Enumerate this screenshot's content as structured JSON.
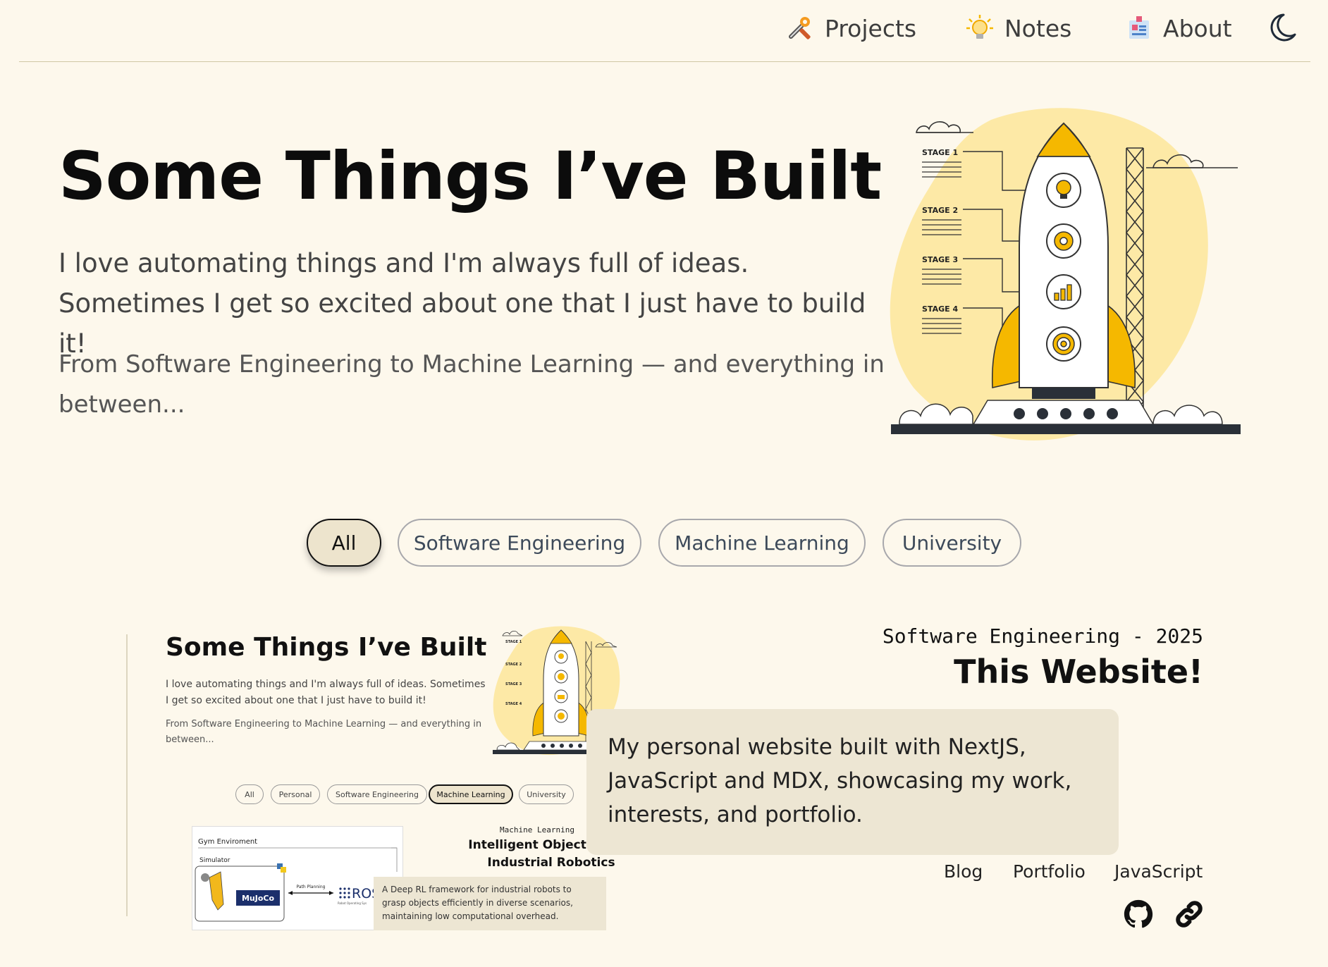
{
  "nav": {
    "items": [
      {
        "label": "Projects",
        "icon": "tools-icon"
      },
      {
        "label": "Notes",
        "icon": "lightbulb-icon"
      },
      {
        "label": "About",
        "icon": "id-card-icon"
      }
    ],
    "theme_toggle_icon": "moon-icon"
  },
  "hero": {
    "title": "Some Things I’ve Built",
    "paragraph1": "I love automating things and I'm always full of ideas. Sometimes I get so excited about one that I just have to build it!",
    "paragraph2": "From Software Engineering to Machine Learning — and everything in between...",
    "illustration": {
      "stages": [
        "STAGE 1",
        "STAGE 2",
        "STAGE 3",
        "STAGE 4"
      ]
    }
  },
  "filters": {
    "items": [
      "All",
      "Software Engineering",
      "Machine Learning",
      "University"
    ],
    "active": "All"
  },
  "project": {
    "category": "Software Engineering - 2025",
    "title": "This Website!",
    "description": "My personal website built with NextJS, JavaScript and MDX, showcasing my work, interests, and portfolio.",
    "tags": [
      "Blog",
      "Portfolio",
      "JavaScript"
    ],
    "links": [
      "github-icon",
      "link-icon"
    ],
    "thumbnail": {
      "title": "Some Things I’ve Built",
      "paragraph1": "I love automating things and I'm always full of ideas. Sometimes I get so excited about one that I just have to build it!",
      "paragraph2": "From Software Engineering to Machine Learning — and everything in between...",
      "filters": [
        "All",
        "Personal",
        "Software Engineering",
        "Machine Learning",
        "University"
      ],
      "active_filter": "Machine Learning",
      "stages": [
        "STAGE 1",
        "STAGE 2",
        "STAGE 3",
        "STAGE 4"
      ],
      "sub_project": {
        "category": "Machine Learning",
        "title_line1": "Intelligent Object Graspi",
        "title_line2": "Industrial Robotics",
        "description": "A Deep RL framework for industrial robots to grasp objects efficiently in diverse scenarios, maintaining low computational overhead.",
        "diagram": {
          "env_label": "Gym Enviroment",
          "sim_label": "Simulator",
          "engine_label": "MuJoCo",
          "arrow_label": "Path Planning",
          "ros_label": "ROS",
          "ros_sub": "Robot Operating Sys"
        }
      }
    }
  },
  "colors": {
    "background": "#fdf8ec",
    "accent_yellow": "#f5b800",
    "blob_yellow": "#fde9a6",
    "card_bg": "#ede6d3",
    "active_pill_bg": "#ede4cd"
  }
}
